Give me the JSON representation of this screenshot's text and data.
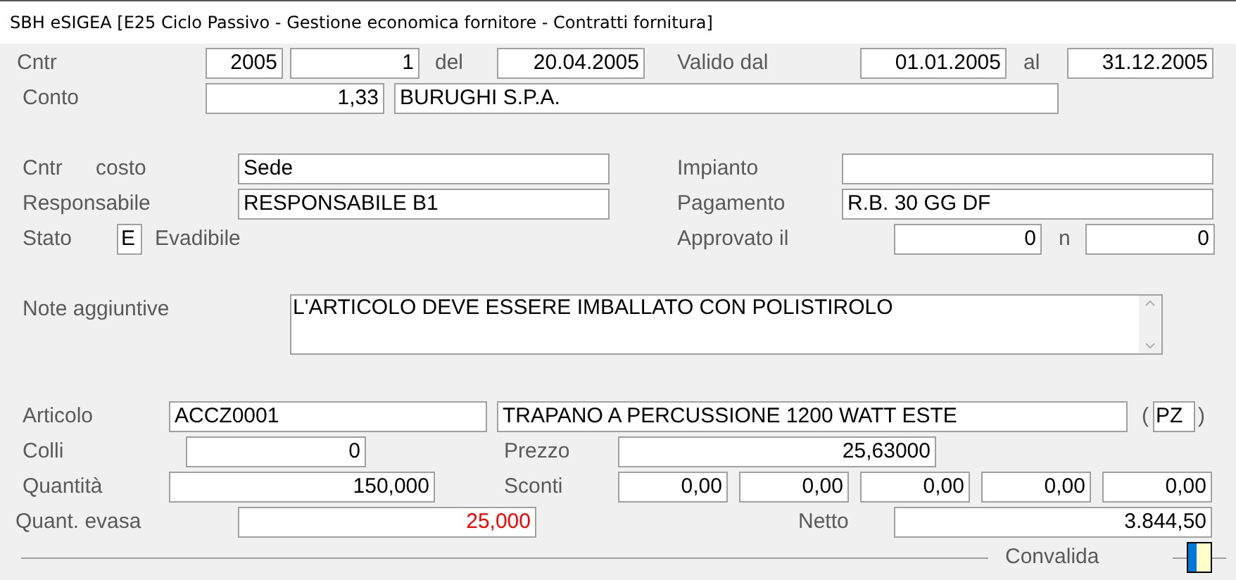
{
  "window": {
    "title": "SBH eSIGEA [E25 Ciclo Passivo - Gestione economica fornitore - Contratti fornitura]"
  },
  "contract": {
    "label": "Cntr",
    "year": "2005",
    "number": "1",
    "date_label": "del",
    "date": "20.04.2005",
    "valid_from_label": "Valido dal",
    "valid_from": "01.01.2005",
    "valid_to_label": "al",
    "valid_to": "31.12.2005"
  },
  "account": {
    "label": "Conto",
    "code": "1,33",
    "name": "BURUGHI S.P.A."
  },
  "cost_center": {
    "label": "Cntr",
    "label_2": "costo",
    "value": "Sede"
  },
  "plant": {
    "label": "Impianto"
  },
  "manager": {
    "label": "Responsabile",
    "value": "RESPONSABILE B1"
  },
  "payment": {
    "label": "Pagamento",
    "value": "R.B. 30 GG DF"
  },
  "status": {
    "label": "Stato",
    "code": "E",
    "description": "Evadibile"
  },
  "approved": {
    "label": "Approvato il",
    "date": "0",
    "number_label": "n",
    "number": "0"
  },
  "notes": {
    "label": "Note aggiuntive",
    "value": "L'ARTICOLO DEVE ESSERE IMBALLATO CON POLISTIROLO"
  },
  "article": {
    "label": "Articolo",
    "code": "ACCZ0001",
    "description": "TRAPANO A PERCUSSIONE 1200 WATT ESTE",
    "paren_open": "(",
    "unit": "PZ",
    "paren_close": ")"
  },
  "packages": {
    "label": "Colli",
    "value": "0"
  },
  "price": {
    "label": "Prezzo",
    "value": "25,63000"
  },
  "quantity": {
    "label": "Quantità",
    "value": "150,000"
  },
  "discounts": {
    "label": "Sconti",
    "values": [
      "0,00",
      "0,00",
      "0,00",
      "0,00",
      "0,00"
    ]
  },
  "delivered": {
    "label": "Quant. evasa",
    "value": "25,000",
    "warning": true
  },
  "net": {
    "label": "Netto",
    "value": "3.844,50"
  },
  "validate": {
    "label": "Convalida",
    "checked": true
  }
}
